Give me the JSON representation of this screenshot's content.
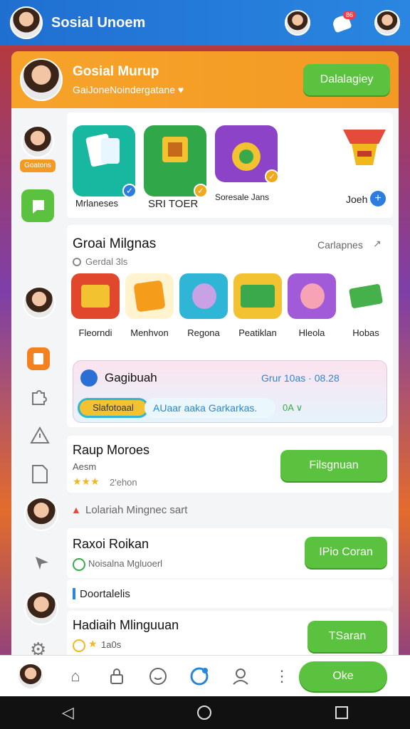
{
  "topbar": {
    "title": "Sosial Unoem",
    "badge": "86"
  },
  "header": {
    "title": "Gosial Murup",
    "subtitle": "GaiJoneNoindergatane ♥",
    "button": "Dalalagiey"
  },
  "games_top": {
    "tiles": [
      {
        "label": "Mrlaneses",
        "color": "#18b7a0"
      },
      {
        "label": "SRI TOER",
        "color": "#30a84a"
      },
      {
        "label": "Soresale Jans",
        "color": "#8c43c7"
      }
    ],
    "side_label": "Joeh",
    "sidebar_badge": "Goatons"
  },
  "section1": {
    "title": "Groai Milgnas",
    "meta": "Gerdal 3ls",
    "link": "Carlapnes",
    "games": [
      {
        "label": "Fleorndi",
        "color": "#e0472c"
      },
      {
        "label": "Menhvon",
        "color": "#f59d1a"
      },
      {
        "label": "Regona",
        "color": "#2fb5d6"
      },
      {
        "label": "Peatiklan",
        "color": "#f2c230"
      },
      {
        "label": "Hleola",
        "color": "#a25bd8"
      },
      {
        "label": "Hobas",
        "color": "#46b04a"
      }
    ],
    "promo": {
      "title": "Gagibuah",
      "time": "Grur 10as · 08.28",
      "chip": "Slafotoaal",
      "input": "AUaar aaka Garkarkas.",
      "extra": "0A ∨"
    }
  },
  "rows": [
    {
      "title": "Raup Moroes",
      "sub": "Aesm",
      "rating": "2'ehon",
      "button": "Filsgnuan"
    },
    {
      "title": "Raxoi Roikan",
      "sub": "Noisalna Mgluoerl",
      "button": "IPio Coran"
    },
    {
      "title": "Hadiaih Mlinguuan",
      "sub": "1a0s",
      "button": "TSaran"
    }
  ],
  "notice": "Lolariah Mingnec sart",
  "subsection": "Doortalelis",
  "nav": {
    "button": "Oke"
  },
  "colors": {
    "accent": "#5bc23f",
    "header": "#f7a32a",
    "topbar": "#1f6fd1"
  }
}
